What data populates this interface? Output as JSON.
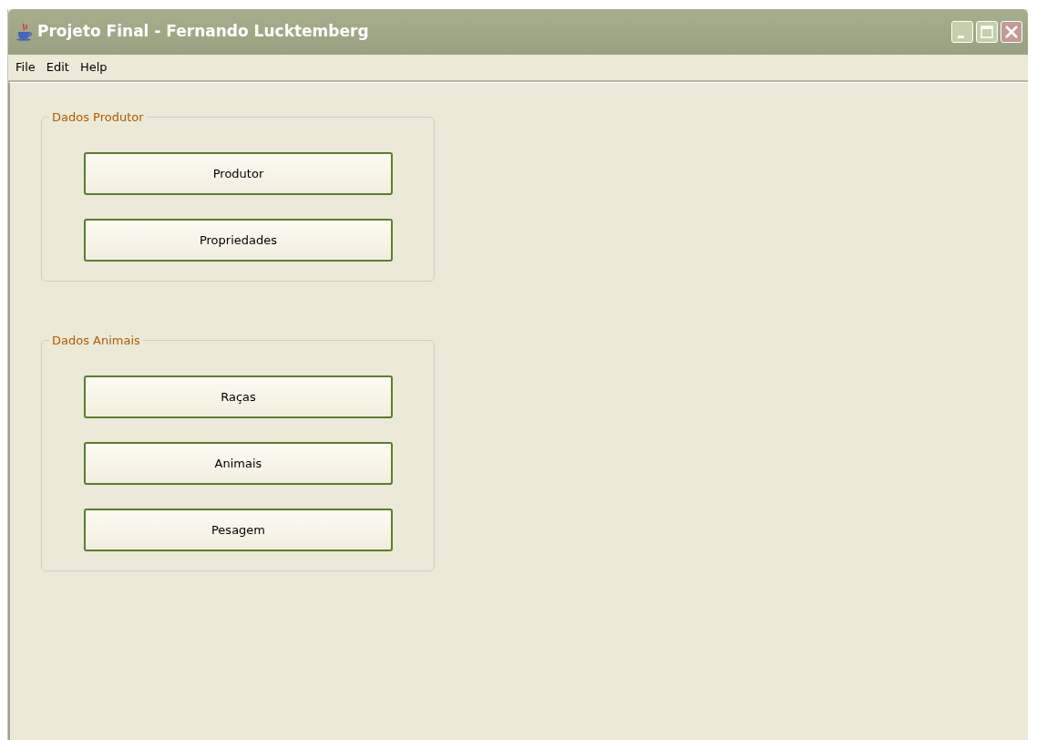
{
  "window": {
    "title": "Projeto Final - Fernando Lucktemberg"
  },
  "menu": [
    "File",
    "Edit",
    "Help"
  ],
  "groups": [
    {
      "title": "Dados Produtor",
      "buttons": [
        "Produtor",
        "Propriedades"
      ]
    },
    {
      "title": "Dados Animais",
      "buttons": [
        "Raças",
        "Animais",
        "Pesagem"
      ]
    }
  ]
}
